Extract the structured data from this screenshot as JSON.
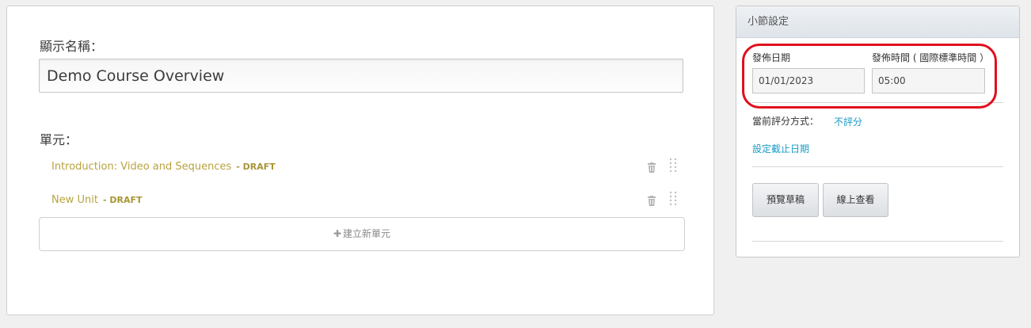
{
  "main": {
    "display_name_label": "顯示名稱：",
    "display_name_value": "Demo Course Overview",
    "units_label": "單元：",
    "units": [
      {
        "title": "Introduction: Video and Sequences",
        "status": "- DRAFT"
      },
      {
        "title": "New Unit",
        "status": "- DRAFT"
      }
    ],
    "new_unit_label": "建立新單元"
  },
  "sidebar": {
    "title": "小節設定",
    "release_date_label": "發佈日期",
    "release_date_value": "01/01/2023",
    "release_time_label": "發佈時間 ( 國際標準時間 ）",
    "release_time_value": "05:00",
    "grading_label": "當前評分方式：",
    "grading_value": "不評分",
    "set_due_date_link": "設定截止日期",
    "preview_draft_button": "預覽草稿",
    "view_live_button": "線上查看"
  },
  "colors": {
    "accent_link": "#1a9bc6",
    "draft_text": "#b8a33f",
    "highlight_ring": "#e0101e"
  }
}
